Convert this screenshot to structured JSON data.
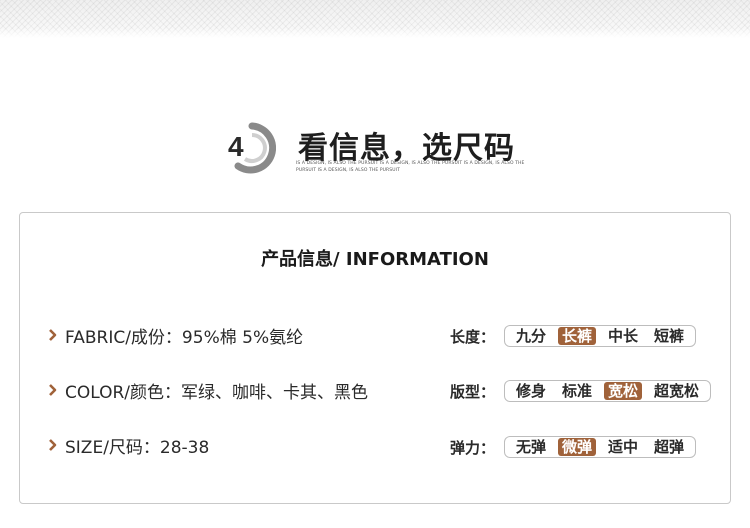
{
  "header": {
    "title": "看信息，选尺码",
    "subtitle": "IS A DESIGN, IS ALSO THE PURSUIT IS A DESIGN, IS ALSO THE PURSUIT IS A DESIGN, IS ALSO THE PURSUIT IS A DESIGN, IS ALSO THE PURSUIT"
  },
  "panel": {
    "title": "产品信息/ INFORMATION",
    "specs": [
      {
        "text": "FABRIC/成份：95%棉 5%氨纶"
      },
      {
        "text": "COLOR/颜色：军绿、咖啡、卡其、黑色"
      },
      {
        "text": "SIZE/尺码：28-38"
      }
    ],
    "attributes": [
      {
        "label": "长度：",
        "options": [
          "九分",
          "长裤",
          "中长",
          "短裤"
        ],
        "selected": 1
      },
      {
        "label": "版型：",
        "options": [
          "修身",
          "标准",
          "宽松",
          "超宽松"
        ],
        "selected": 2
      },
      {
        "label": "弹力：",
        "options": [
          "无弹",
          "微弹",
          "适中",
          "超弹"
        ],
        "selected": 1
      }
    ]
  },
  "colors": {
    "accent": "#a0623a",
    "chevron": "#a0623a"
  }
}
